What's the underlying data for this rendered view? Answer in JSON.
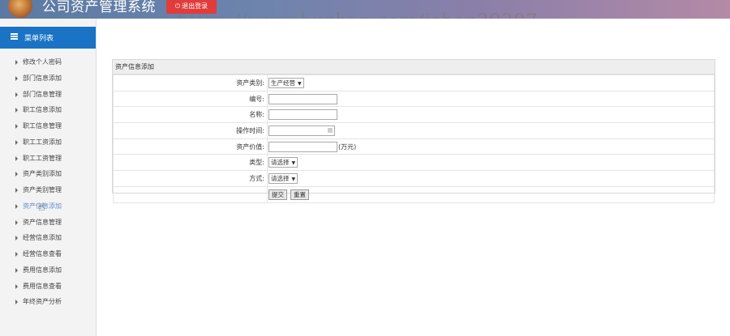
{
  "header": {
    "app_title": "公司资产管理系统",
    "logout_label": "退出登录",
    "watermark": "https://www.huzhan.com/ishop39397"
  },
  "sidebar": {
    "title": "菜单列表",
    "items": [
      {
        "label": "修改个人密码"
      },
      {
        "label": "部门信息添加"
      },
      {
        "label": "部门信息管理"
      },
      {
        "label": "职工信息添加"
      },
      {
        "label": "职工信息管理"
      },
      {
        "label": "职工工资添加"
      },
      {
        "label": "职工工资管理"
      },
      {
        "label": "资产类别添加"
      },
      {
        "label": "资产类别管理"
      },
      {
        "label": "资产信息添加",
        "active": true
      },
      {
        "label": "资产信息管理"
      },
      {
        "label": "经营信息添加"
      },
      {
        "label": "经营信息查看"
      },
      {
        "label": "费用信息添加"
      },
      {
        "label": "费用信息查看"
      },
      {
        "label": "年终资产分析"
      }
    ]
  },
  "form": {
    "title": "资产信息添加",
    "fields": {
      "category": {
        "label": "资产类别:",
        "value": "生产经营"
      },
      "number": {
        "label": "编号:",
        "value": ""
      },
      "name": {
        "label": "名称:",
        "value": ""
      },
      "time": {
        "label": "操作时间:",
        "value": ""
      },
      "price": {
        "label": "资产价值:",
        "value": "",
        "unit": "(万元)"
      },
      "type": {
        "label": "类型:",
        "value": "请选择"
      },
      "method": {
        "label": "方式:",
        "value": "请选择"
      }
    },
    "submit_label": "提交",
    "reset_label": "重置"
  }
}
